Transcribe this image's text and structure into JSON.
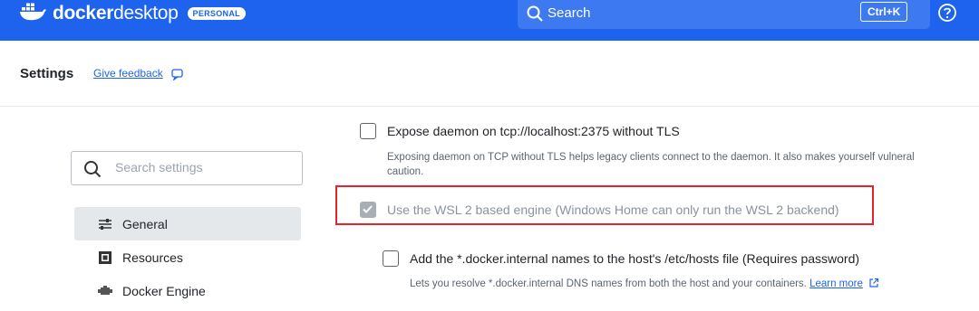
{
  "app": {
    "brand_part1": "docker",
    "brand_part2": "desktop",
    "plan_badge": "PERSONAL",
    "search_label": "Search",
    "search_shortcut": "Ctrl+K",
    "help_icon": "question-circle-icon"
  },
  "header": {
    "title": "Settings",
    "feedback_link": "Give feedback"
  },
  "sidebar": {
    "search_placeholder": "Search settings",
    "items": [
      {
        "label": "General",
        "icon": "sliders-icon",
        "active": true
      },
      {
        "label": "Resources",
        "icon": "resources-icon",
        "active": false
      },
      {
        "label": "Docker Engine",
        "icon": "engine-icon",
        "active": false
      }
    ]
  },
  "options": {
    "expose_daemon": {
      "label": "Expose daemon on tcp://localhost:2375 without TLS",
      "description_line1": "Exposing daemon on TCP without TLS helps legacy clients connect to the daemon. It also makes yourself vulneral",
      "description_line2": "caution.",
      "checked": false
    },
    "wsl2_engine": {
      "label": "Use the WSL 2 based engine (Windows Home can only run the WSL 2 backend)",
      "checked": true,
      "disabled": true
    },
    "hosts_file": {
      "label": "Add the *.docker.internal names to the host's /etc/hosts file (Requires password)",
      "description": "Lets you resolve *.docker.internal DNS names from both the host and your containers.",
      "learn_more": "Learn more",
      "checked": false
    }
  },
  "colors": {
    "topbar": "#1d63ed",
    "highlight": "#e3242b",
    "link": "#1d63ed"
  }
}
